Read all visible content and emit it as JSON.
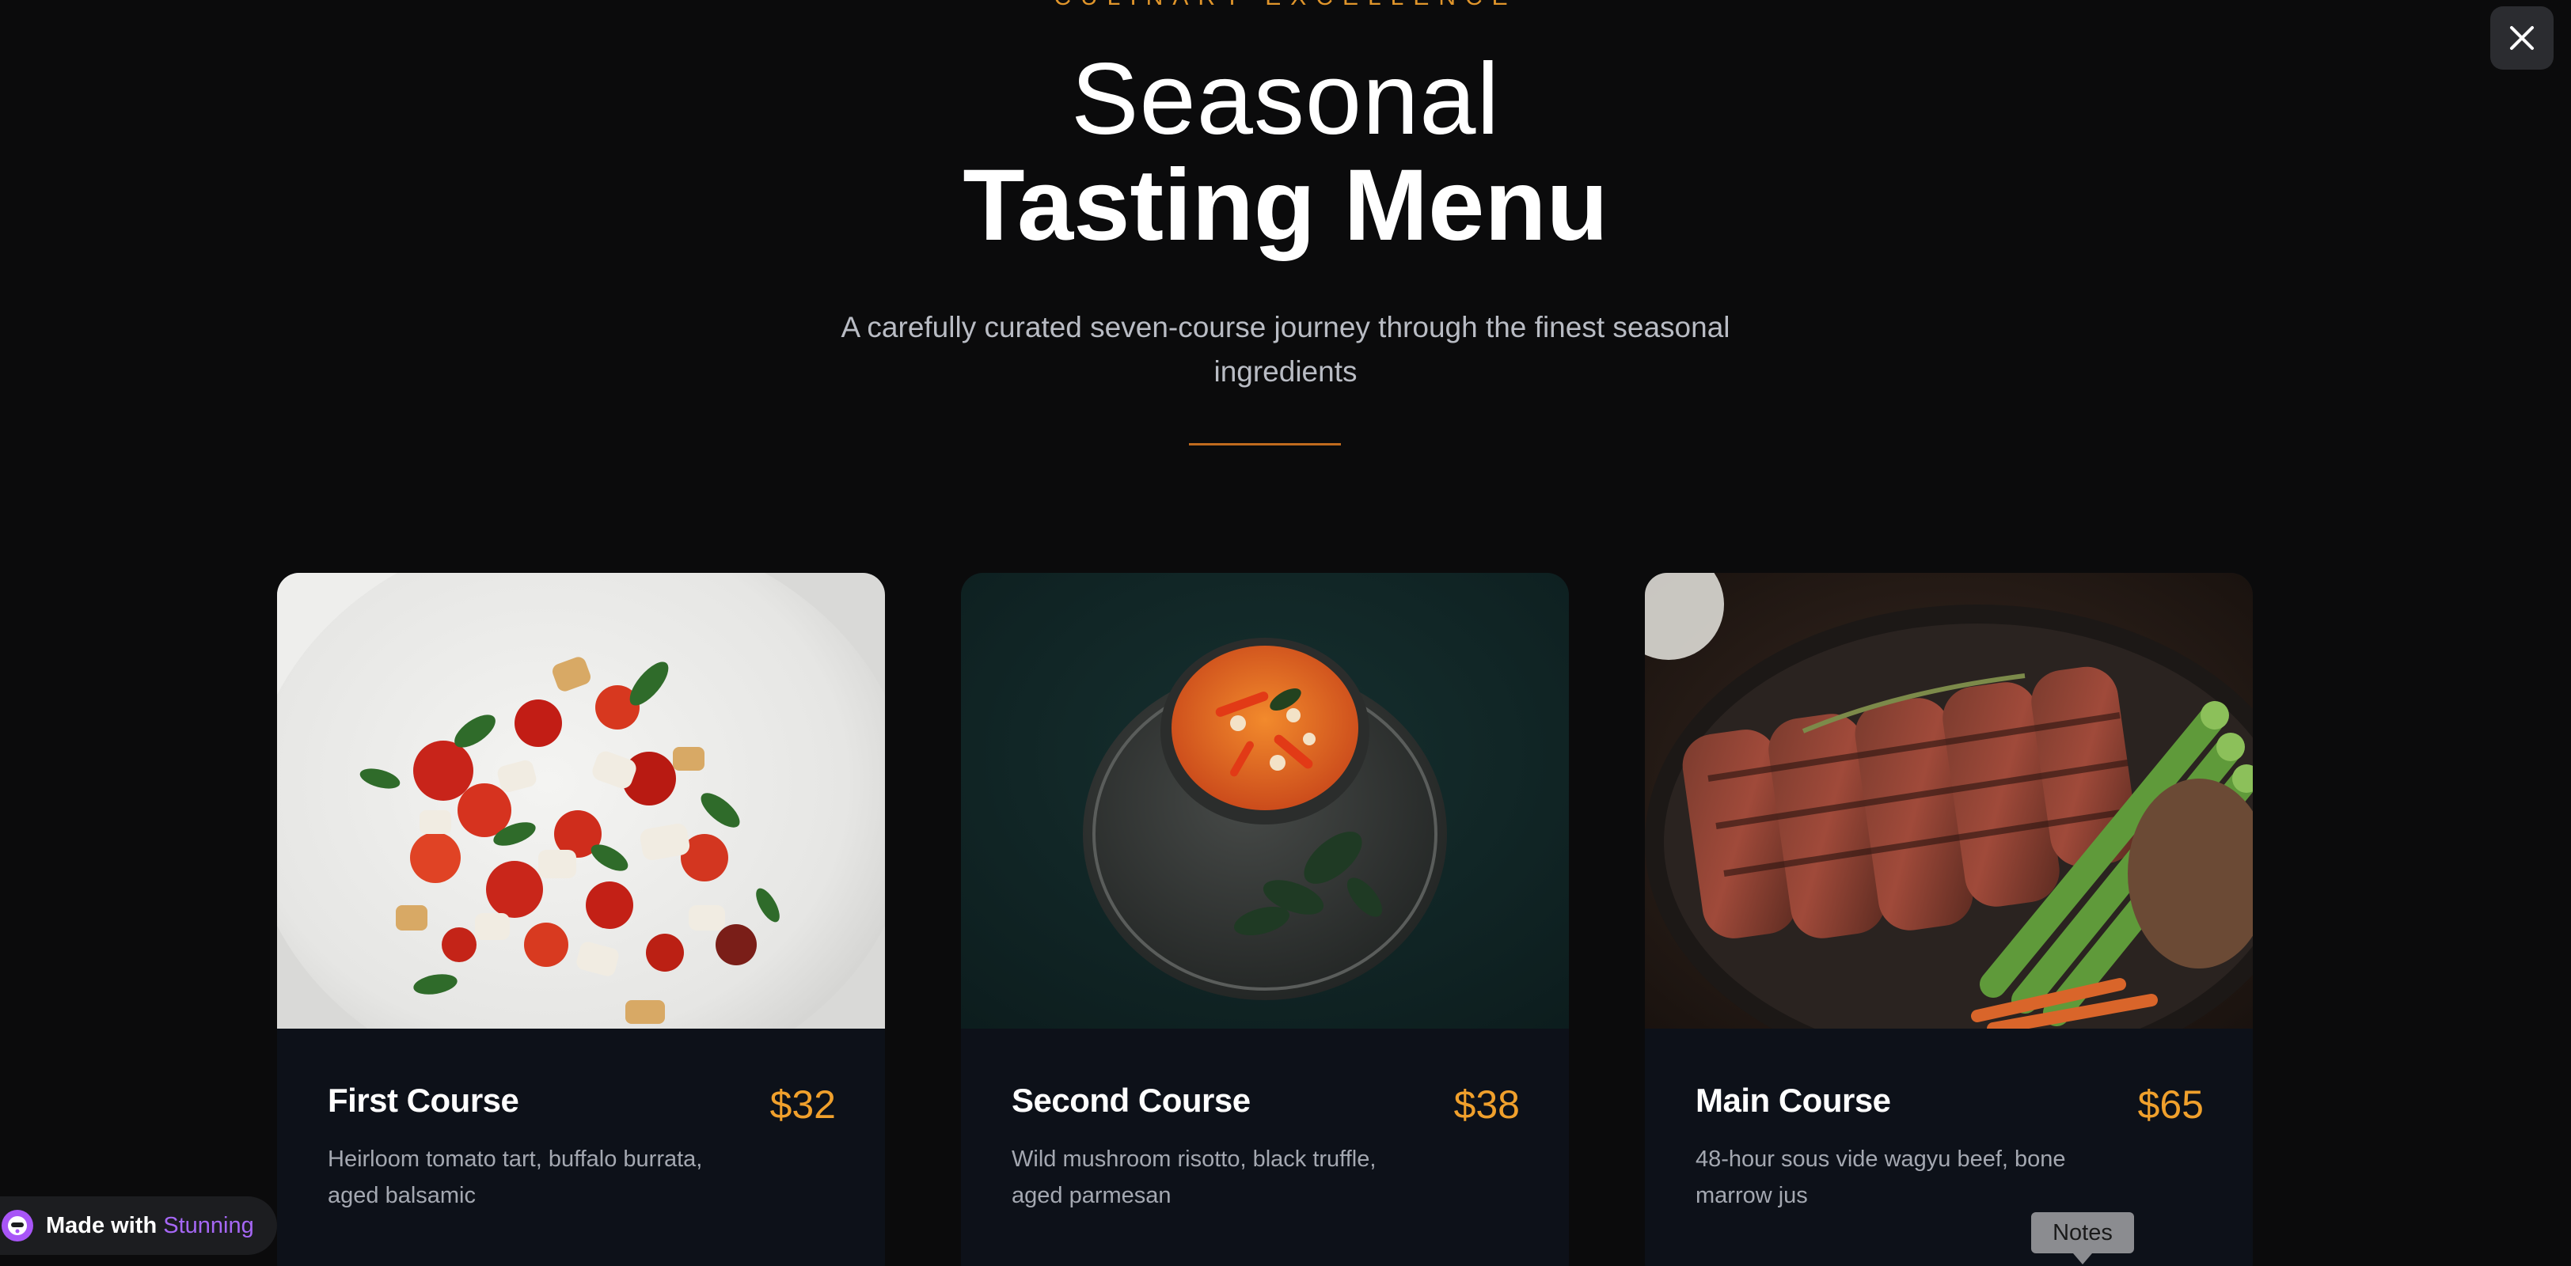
{
  "header": {
    "eyebrow": "CULINARY EXCELLENCE",
    "title_line1": "Seasonal",
    "title_line2": "Tasting Menu",
    "subtitle": "A carefully curated seven-course journey through the finest seasonal ingredients"
  },
  "close": {
    "icon": "close-icon"
  },
  "courses": [
    {
      "title": "First Course",
      "price": "$32",
      "description": "Heirloom tomato tart, buffalo burrata, aged balsamic",
      "image": "tomato-burrata-salad"
    },
    {
      "title": "Second Course",
      "price": "$38",
      "description": "Wild mushroom risotto, black truffle, aged parmesan",
      "image": "soup-bowl-dark-plate"
    },
    {
      "title": "Main Course",
      "price": "$65",
      "description": "48-hour sous vide wagyu beef, bone marrow jus",
      "image": "grilled-steak-asparagus"
    }
  ],
  "badge": {
    "prefix": "Made with",
    "brand": "Stunning"
  },
  "tooltip": {
    "label": "Notes"
  },
  "colors": {
    "background": "#0b0b0c",
    "accent": "#f0a02c",
    "eyebrow": "#e0952b",
    "card_body": "#0d1119",
    "brand": "#a667f5"
  }
}
